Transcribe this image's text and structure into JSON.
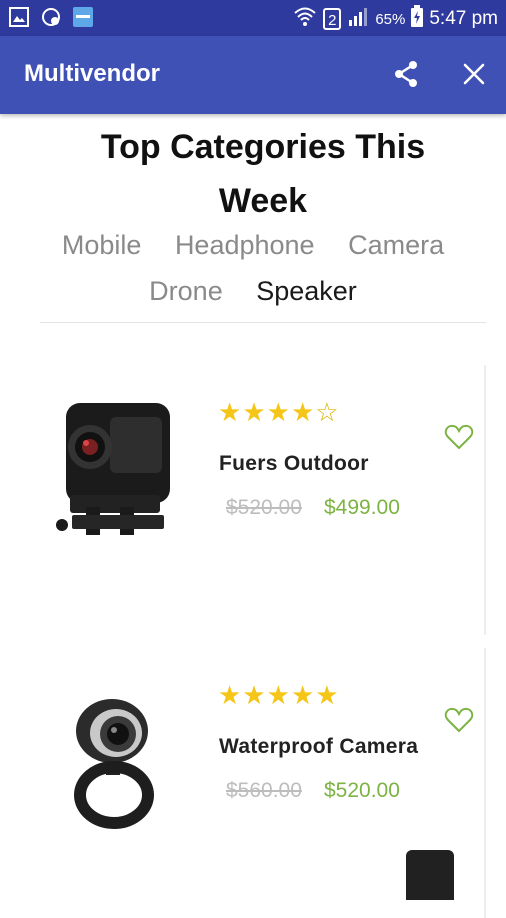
{
  "status_bar": {
    "battery": "65%",
    "time": "5:47 pm",
    "sim_slot": "2"
  },
  "app_bar": {
    "title": "Multivendor"
  },
  "section": {
    "heading_line1": "Top Categories This",
    "heading_line2": "Week",
    "categories": [
      "Mobile",
      "Headphone",
      "Camera",
      "Drone",
      "Speaker"
    ],
    "active_category": "Speaker"
  },
  "products": [
    {
      "name": "Fuers Outdoor",
      "old_price": "$520.00",
      "price": "$499.00",
      "rating": 4,
      "max_rating": 5
    },
    {
      "name": "Waterproof Camera",
      "old_price": "$560.00",
      "price": "$520.00",
      "rating": 5,
      "max_rating": 5
    }
  ],
  "icons": [
    "image-icon",
    "whatsapp-icon",
    "app-icon",
    "wifi-icon",
    "signal-icon",
    "battery-icon",
    "share-icon",
    "close-icon",
    "heart-icon",
    "star-icon"
  ],
  "colors": {
    "status_bar": "#2f3a9e",
    "app_bar": "#3f51b5",
    "price": "#7cb342",
    "star": "#f5c518"
  }
}
